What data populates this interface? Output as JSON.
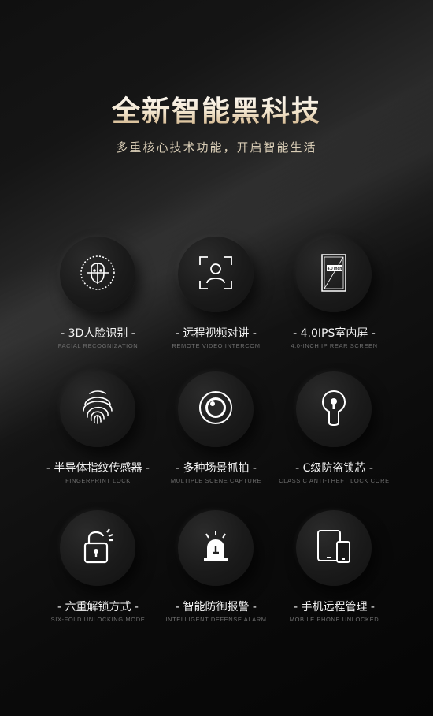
{
  "header": {
    "title": "全新智能黑科技",
    "subtitle": "多重核心技术功能，开启智能生活"
  },
  "colors": {
    "title_gold": "#caa878",
    "subtitle": "#d9cdb6",
    "label": "#f2f2f2",
    "sub_label": "#6e6e6e"
  },
  "features": [
    {
      "label": "- 3D人脸识别 -",
      "sub": "FACIAL RECOGNIZATION",
      "icon": "face-scan-icon"
    },
    {
      "label": "- 远程视频对讲 -",
      "sub": "REMOTE VIDEO INTERCOM",
      "icon": "person-frame-icon"
    },
    {
      "label": "- 4.0IPS室内屏 -",
      "sub": "4.0-INCH IP REAR SCREEN",
      "icon": "screen-icon",
      "screen_text": "4.0 inch"
    },
    {
      "label": "- 半导体指纹传感器 -",
      "sub": "FINGERPRINT LOCK",
      "icon": "fingerprint-icon"
    },
    {
      "label": "- 多种场景抓拍 -",
      "sub": "MULTIPLE SCENE CAPTURE",
      "icon": "camera-lens-icon"
    },
    {
      "label": "- C级防盗锁芯 -",
      "sub": "CLASS C ANTI-THEFT LOCK CORE",
      "icon": "lock-core-icon"
    },
    {
      "label": "- 六重解锁方式 -",
      "sub": "SIX-FOLD UNLOCKING MODE",
      "icon": "padlock-icon"
    },
    {
      "label": "- 智能防御报警 -",
      "sub": "INTELLIGENT DEFENSE ALARM",
      "icon": "alarm-icon"
    },
    {
      "label": "- 手机远程管理 -",
      "sub": "MOBILE PHONE UNLOCKED",
      "icon": "mobile-devices-icon"
    }
  ]
}
